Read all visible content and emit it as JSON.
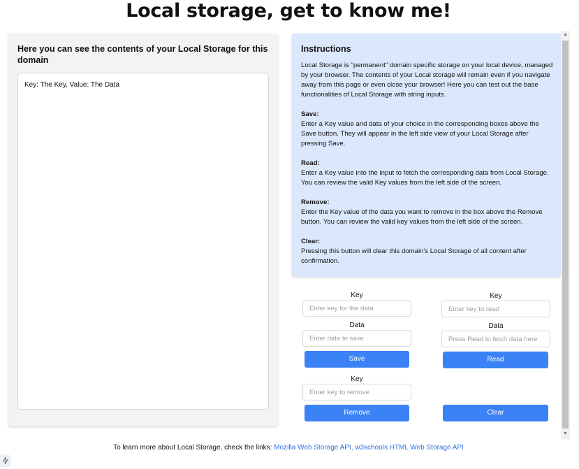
{
  "page": {
    "title": "Local storage, get to know me!"
  },
  "storage_view": {
    "heading": "Here you can see the contents of your Local Storage for this domain",
    "entries": [
      "Key: The Key, Value: The Data"
    ]
  },
  "instructions": {
    "title": "Instructions",
    "intro": "Local Storage is \"permanent\" domain specific storage on your local device, managed by your browser. The contents of your Local storage will remain even if you navigate away from this page or even close your browser! Here you can test out the base functionalities of Local Storage with string inputs.",
    "save_heading": "Save:",
    "save_text": "Enter a Key value and data of your choice in the corresponding boxes above the Save button. They will appear in the left side view of your Local Storage after pressing Save.",
    "read_heading": "Read:",
    "read_text": "Enter a Key value into the input to fetch the corresponding data from Local Storage. You can review the valid Key values from the left side of the screen.",
    "remove_heading": "Remove:",
    "remove_text": "Enter the Key value of the data you want to remove in the box above the Remove button. You can review the valid key values from the left side of the screen.",
    "clear_heading": "Clear:",
    "clear_text": "Pressing this button will clear this domain's Local Storage of all content after confirmation."
  },
  "save_form": {
    "key_label": "Key",
    "key_placeholder": "Enter key for the data",
    "data_label": "Data",
    "data_placeholder": "Enter data to save",
    "button": "Save"
  },
  "read_form": {
    "key_label": "Key",
    "key_placeholder": "Enter key to read",
    "data_label": "Data",
    "data_placeholder": "Press Read to fetch data here",
    "button": "Read"
  },
  "remove_form": {
    "key_label": "Key",
    "key_placeholder": "Enter key to remove",
    "button": "Remove"
  },
  "clear_form": {
    "button": "Clear"
  },
  "footer": {
    "text": "To learn more about Local Storage, check the links: ",
    "link_mdn": "Mozilla Web Storage API",
    "separator": ", ",
    "link_w3": "w3schools HTML Web Storage API"
  },
  "theme": {
    "accent": "#3b82f6",
    "instructions_bg": "#dbe8fc",
    "panel_bg": "#f2f3f5",
    "link": "#2f6fe4"
  },
  "icons": {
    "scroll_up": "chevron-up-icon",
    "scroll_down": "chevron-down-icon",
    "corner": "lightning-icon"
  }
}
